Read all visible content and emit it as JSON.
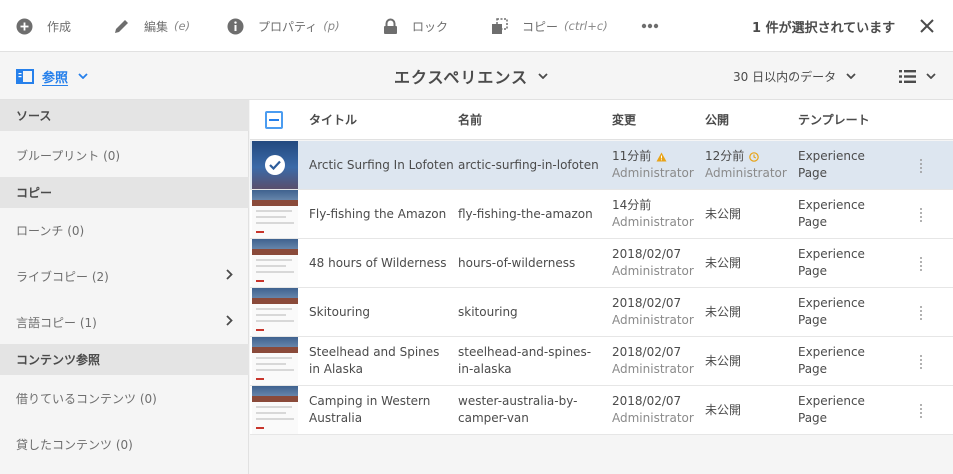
{
  "toolbar": {
    "create_label": "作成",
    "edit_label": "編集",
    "edit_shortcut": "(e)",
    "properties_label": "プロパティ",
    "properties_shortcut": "(p)",
    "lock_label": "ロック",
    "copy_label": "コピー",
    "copy_shortcut": "(ctrl+c)",
    "selection_text": "1 件が選択されています"
  },
  "header": {
    "rail_label": "参照",
    "title": "エクスペリエンス",
    "filter_label": "30 日以内のデータ"
  },
  "rail": {
    "sections": [
      {
        "heading": "ソース",
        "items": [
          {
            "label": "ブループリント (0)"
          }
        ]
      },
      {
        "heading": "コピー",
        "items": [
          {
            "label": "ローンチ (0)"
          },
          {
            "label": "ライブコピー (2)"
          },
          {
            "label": "言語コピー (1)"
          }
        ]
      },
      {
        "heading": "コンテンツ参照",
        "items": [
          {
            "label": "借りているコンテンツ (0)"
          },
          {
            "label": "貸したコンテンツ (0)"
          }
        ]
      }
    ]
  },
  "table": {
    "columns": {
      "title": "タイトル",
      "name": "名前",
      "modified": "変更",
      "published": "公開",
      "template": "テンプレート"
    },
    "rows": [
      {
        "title": "Arctic Surfing In Lofoten",
        "name": "arctic-surfing-in-lofoten",
        "modified": "11分前",
        "modified_by": "Administrator",
        "published": "12分前",
        "published_by": "Administrator",
        "template": "Experience Page"
      },
      {
        "title": "Fly-fishing the Amazon",
        "name": "fly-fishing-the-amazon",
        "modified": "14分前",
        "modified_by": "Administrator",
        "published": "未公開",
        "published_by": "",
        "template": "Experience Page"
      },
      {
        "title": "48 hours of Wilderness",
        "name": "hours-of-wilderness",
        "modified": "2018/02/07",
        "modified_by": "Administrator",
        "published": "未公開",
        "published_by": "",
        "template": "Experience Page"
      },
      {
        "title": "Skitouring",
        "name": "skitouring",
        "modified": "2018/02/07",
        "modified_by": "Administrator",
        "published": "未公開",
        "published_by": "",
        "template": "Experience Page"
      },
      {
        "title": "Steelhead and Spines in Alaska",
        "name": "steelhead-and-spines-in-alaska",
        "modified": "2018/02/07",
        "modified_by": "Administrator",
        "published": "未公開",
        "published_by": "",
        "template": "Experience Page"
      },
      {
        "title": "Camping in Western Australia",
        "name": "wester-australia-by-camper-van",
        "modified": "2018/02/07",
        "modified_by": "Administrator",
        "published": "未公開",
        "published_by": "",
        "template": "Experience Page"
      }
    ]
  },
  "colors": {
    "accent": "#2680eb",
    "warning": "#e8a317",
    "selected_row": "#dde6f0"
  }
}
